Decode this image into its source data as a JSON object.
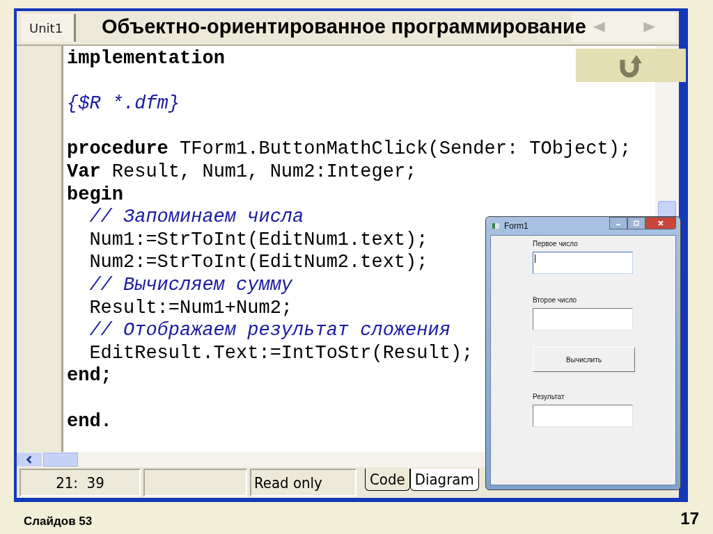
{
  "slide": {
    "title": "Объектно-ориентированное программирование",
    "footer": "Слайдов 53",
    "page_number": "17"
  },
  "editor": {
    "tabs": [
      {
        "label": "Unit1",
        "selected": true
      }
    ],
    "code_lines": [
      {
        "kind": "code",
        "segments": [
          {
            "kind": "keyword",
            "text": "implementation"
          }
        ]
      },
      {
        "kind": "blank"
      },
      {
        "kind": "code",
        "segments": [
          {
            "kind": "comment",
            "text": "{$R *.dfm}"
          }
        ]
      },
      {
        "kind": "blank"
      },
      {
        "kind": "code",
        "segments": [
          {
            "kind": "keyword",
            "text": "procedure"
          },
          {
            "kind": "plain",
            "text": " TForm1.ButtonMathClick(Sender: TObject);"
          }
        ]
      },
      {
        "kind": "code",
        "segments": [
          {
            "kind": "keyword",
            "text": "Var"
          },
          {
            "kind": "plain",
            "text": " Result, Num1, Num2:Integer;"
          }
        ]
      },
      {
        "kind": "code",
        "segments": [
          {
            "kind": "keyword",
            "text": "begin"
          }
        ]
      },
      {
        "kind": "indented",
        "segments": [
          {
            "kind": "comment",
            "text": "// Запоминаем числа"
          }
        ]
      },
      {
        "kind": "indented",
        "segments": [
          {
            "kind": "plain",
            "text": "Num1:=StrToInt(EditNum1.text);"
          }
        ]
      },
      {
        "kind": "indented",
        "segments": [
          {
            "kind": "plain",
            "text": "Num2:=StrToInt(EditNum2.text);"
          }
        ]
      },
      {
        "kind": "indented",
        "segments": [
          {
            "kind": "comment",
            "text": "// Вычисляем сумму"
          }
        ]
      },
      {
        "kind": "indented",
        "segments": [
          {
            "kind": "plain",
            "text": "Result:=Num1+Num2;"
          }
        ]
      },
      {
        "kind": "indented",
        "segments": [
          {
            "kind": "comment",
            "text": "// Отображаем результат сложения"
          }
        ]
      },
      {
        "kind": "indented",
        "segments": [
          {
            "kind": "plain",
            "text": "EditResult.Text:=IntToStr(Result);"
          }
        ]
      },
      {
        "kind": "code",
        "segments": [
          {
            "kind": "keyword",
            "text": "end;"
          }
        ]
      },
      {
        "kind": "blank"
      },
      {
        "kind": "code",
        "segments": [
          {
            "kind": "keyword",
            "text": "end."
          }
        ]
      }
    ]
  },
  "status_bar": {
    "position": "21:  39",
    "mode": "Read only",
    "tabs": [
      {
        "label": "Code",
        "selected": true
      },
      {
        "label": "Diagram",
        "selected": false
      }
    ]
  },
  "form_window": {
    "title": "Form1",
    "fields": [
      {
        "label": "Первое число",
        "focused": true
      },
      {
        "label": "Второе число",
        "focused": false
      }
    ],
    "button": "Вычислить",
    "result": {
      "label": "Результат",
      "focused": false
    }
  }
}
